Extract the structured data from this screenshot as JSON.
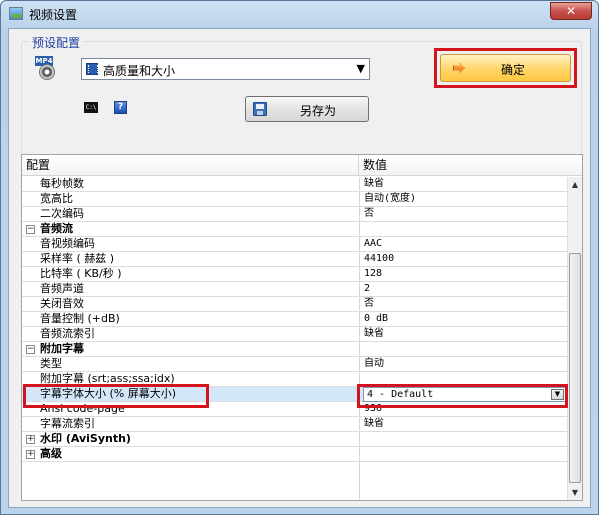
{
  "window": {
    "title": "视频设置",
    "close_glyph": "✕",
    "icon": "app-settings-icon"
  },
  "preset": {
    "group_label": "预设配置",
    "file_icon": "mp4-file-icon",
    "file_icon_label": "MP4",
    "selected": "高质量和大小",
    "dropdown_glyph": "▼",
    "cmd_icon_label": "C:\\",
    "help_label": "?"
  },
  "buttons": {
    "ok": "确定",
    "save_as": "另存为"
  },
  "grid": {
    "col_name": "配置",
    "col_value": "数值",
    "rows": [
      {
        "type": "item",
        "name": "每秒帧数",
        "value": "缺省"
      },
      {
        "type": "item",
        "name": "宽高比",
        "value": "自动(宽度)"
      },
      {
        "type": "item",
        "name": "二次编码",
        "value": "否"
      },
      {
        "type": "cat",
        "name": "音频流",
        "toggle": "−"
      },
      {
        "type": "item",
        "name": "音视频编码",
        "value": "AAC"
      },
      {
        "type": "item",
        "name": "采样率 ( 赫兹 )",
        "value": "44100"
      },
      {
        "type": "item",
        "name": "比特率 ( KB/秒 )",
        "value": "128"
      },
      {
        "type": "item",
        "name": "音频声道",
        "value": "2"
      },
      {
        "type": "item",
        "name": "关闭音效",
        "value": "否"
      },
      {
        "type": "item",
        "name": "音量控制 (+dB)",
        "value": "0 dB"
      },
      {
        "type": "item",
        "name": "音频流索引",
        "value": "缺省"
      },
      {
        "type": "cat",
        "name": "附加字幕",
        "toggle": "−"
      },
      {
        "type": "item",
        "name": "类型",
        "value": "自动"
      },
      {
        "type": "item",
        "name": "附加字幕 (srt;ass;ssa;idx)",
        "value": ""
      },
      {
        "type": "selected",
        "name": "字幕字体大小 (% 屏幕大小)",
        "value": "4 - Default"
      },
      {
        "type": "item",
        "name": "Ansi code-page",
        "value": "936"
      },
      {
        "type": "item",
        "name": "字幕流索引",
        "value": "缺省"
      },
      {
        "type": "cat",
        "name": "水印 (AviSynth)",
        "toggle": "+"
      },
      {
        "type": "cat",
        "name": "高级",
        "toggle": "+"
      }
    ]
  },
  "colors": {
    "highlight": "#d4141c",
    "selection": "#d3e7f8"
  }
}
